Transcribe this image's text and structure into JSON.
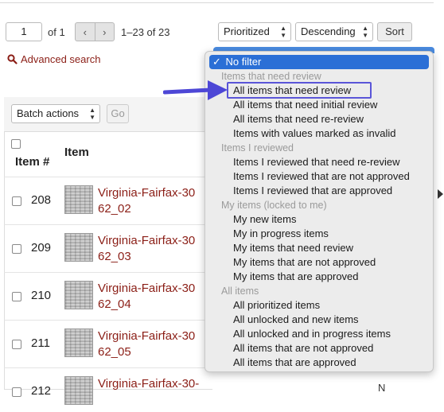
{
  "pager": {
    "page_value": "1",
    "of_label": "of 1",
    "prev_symbol": "‹",
    "next_symbol": "›",
    "range": "1–23 of 23"
  },
  "sort": {
    "field_value": "Prioritized",
    "order_value": "Descending",
    "button_label": "Sort"
  },
  "advanced_search": {
    "label": "Advanced search",
    "icon": "search-icon"
  },
  "batch": {
    "select_value": "Batch actions",
    "go_label": "Go"
  },
  "table": {
    "col_item_num": "Item #",
    "col_item": "Item",
    "rows": [
      {
        "num": "208",
        "title_line1": "Virginia-Fairfax-30",
        "title_line2": "62_02"
      },
      {
        "num": "209",
        "title_line1": "Virginia-Fairfax-30",
        "title_line2": "62_03"
      },
      {
        "num": "210",
        "title_line1": "Virginia-Fairfax-30",
        "title_line2": "62_04"
      },
      {
        "num": "211",
        "title_line1": "Virginia-Fairfax-30",
        "title_line2": "62_05"
      },
      {
        "num": "212",
        "title_line1": "Virginia-Fairfax-30-",
        "title_line2": ""
      }
    ],
    "right_partial": "N"
  },
  "filter_dropdown": {
    "selected": "No filter",
    "check": "✓",
    "groups": [
      {
        "label": "Items that need review",
        "items": [
          "All items that need review",
          "All items that need initial review",
          "All items that need re-review",
          "Items with values marked as invalid"
        ]
      },
      {
        "label": "Items I reviewed",
        "items": [
          "Items I reviewed that need re-review",
          "Items I reviewed that are not approved",
          "Items I reviewed that are approved"
        ]
      },
      {
        "label": "My items (locked to me)",
        "items": [
          "My new items",
          "My in progress items",
          "My items that need review",
          "My items that are not approved",
          "My items that are approved"
        ]
      },
      {
        "label": "All items",
        "items": [
          "All prioritized items",
          "All unlocked and new items",
          "All unlocked and in progress items",
          "All items that are not approved",
          "All items that are approved"
        ]
      }
    ]
  },
  "colors": {
    "link_red": "#8b1e16",
    "selection_blue": "#2b6fd6",
    "annotation_purple": "#5a55d8"
  }
}
